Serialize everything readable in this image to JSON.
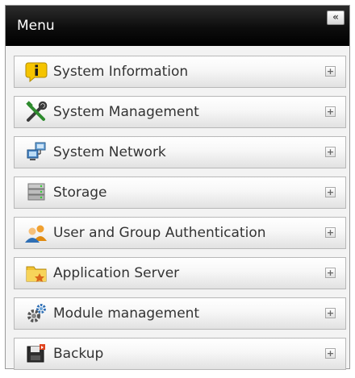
{
  "header": {
    "title": "Menu",
    "collapse_symbol": "«"
  },
  "menu": {
    "items": [
      {
        "label": "System Information",
        "icon": "info-icon"
      },
      {
        "label": "System Management",
        "icon": "tools-icon"
      },
      {
        "label": "System Network",
        "icon": "network-icon"
      },
      {
        "label": "Storage",
        "icon": "storage-icon"
      },
      {
        "label": "User and Group Authentication",
        "icon": "users-icon"
      },
      {
        "label": "Application Server",
        "icon": "folder-icon"
      },
      {
        "label": "Module management",
        "icon": "gears-icon"
      },
      {
        "label": "Backup",
        "icon": "backup-icon"
      }
    ],
    "expand_symbol": "+"
  },
  "colors": {
    "header_bg": "#000000",
    "header_text": "#ffffff",
    "item_text": "#333333",
    "panel_bg": "#f3f3f3"
  }
}
